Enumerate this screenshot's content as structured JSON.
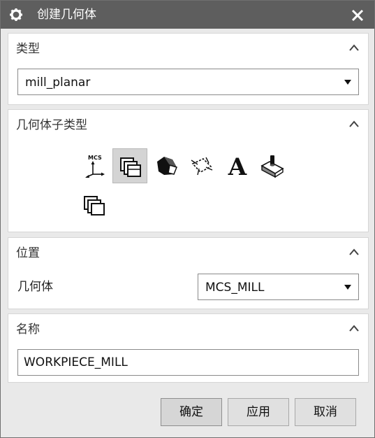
{
  "window": {
    "title": "创建几何体",
    "gear_icon": "gear-icon",
    "close_icon": "close-icon"
  },
  "type_section": {
    "title": "类型",
    "selected": "mill_planar"
  },
  "subtype_section": {
    "title": "几何体子类型",
    "icons": [
      {
        "name": "mcs-icon",
        "label": "MCS",
        "selected": false
      },
      {
        "name": "workpiece-icon",
        "selected": true
      },
      {
        "name": "mill-area-icon",
        "selected": false
      },
      {
        "name": "mill-boundary-icon",
        "selected": false
      },
      {
        "name": "mill-text-icon",
        "glyph": "A",
        "selected": false
      },
      {
        "name": "mill-geom-icon",
        "selected": false
      },
      {
        "name": "workpiece-2-icon",
        "selected": false
      }
    ]
  },
  "position_section": {
    "title": "位置",
    "label": "几何体",
    "selected": "MCS_MILL"
  },
  "name_section": {
    "title": "名称",
    "value": "WORKPIECE_MILL"
  },
  "buttons": {
    "ok": "确定",
    "apply": "应用",
    "cancel": "取消"
  },
  "colors": {
    "titlebar": "#5e5e5e",
    "dialog_bg": "#e9e9e9",
    "selected_icon_bg": "#d4d4d4"
  }
}
